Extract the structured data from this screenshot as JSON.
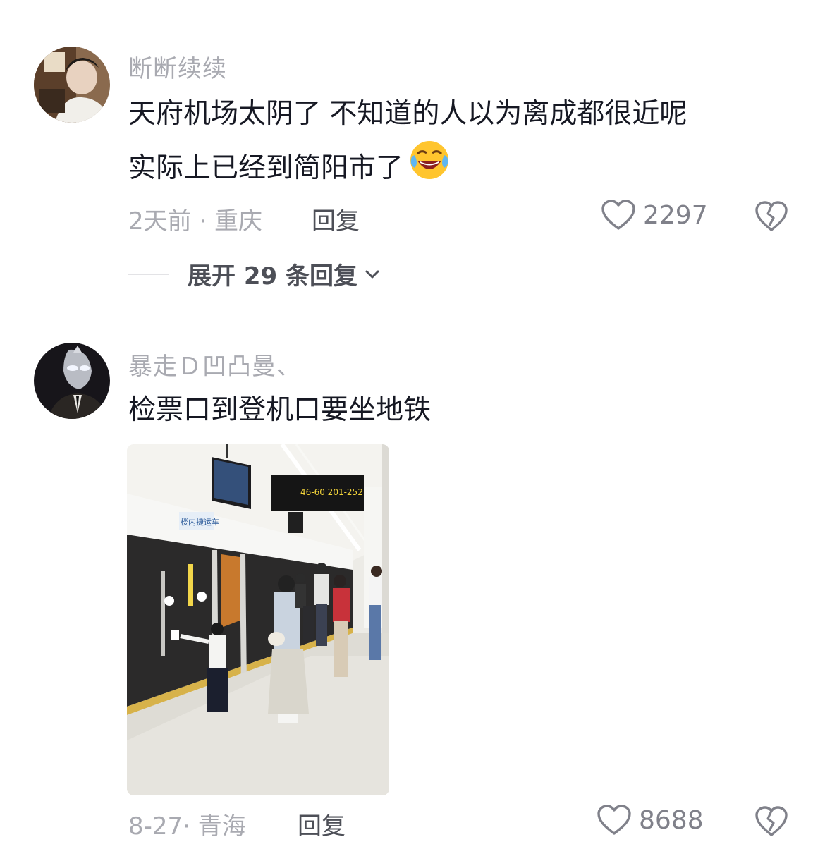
{
  "comments": [
    {
      "username": "断断续续",
      "text_line1": "天府机场太阴了 不知道的人以为离成都很近呢",
      "text_line2": "实际上已经到简阳市了",
      "emoji": "laughing-crying-emoji",
      "time_location": "2天前 · 重庆",
      "reply_label": "回复",
      "likes": "2297",
      "expand_label": "展开 29 条回复"
    },
    {
      "username": "暴走Ｄ凹凸曼、",
      "text_line1": "检票口到登机口要坐地铁",
      "photo": {
        "sign_code": "46-60 201-252",
        "platform_sign": "楼内捷运车"
      },
      "time_location": "8-27· 青海",
      "reply_label": "回复",
      "likes": "8688"
    }
  ],
  "colors": {
    "username": "#a9aab1",
    "body_text": "#161823",
    "meta": "#a9aab1",
    "reply": "#4d4f57",
    "like": "#80818a"
  }
}
